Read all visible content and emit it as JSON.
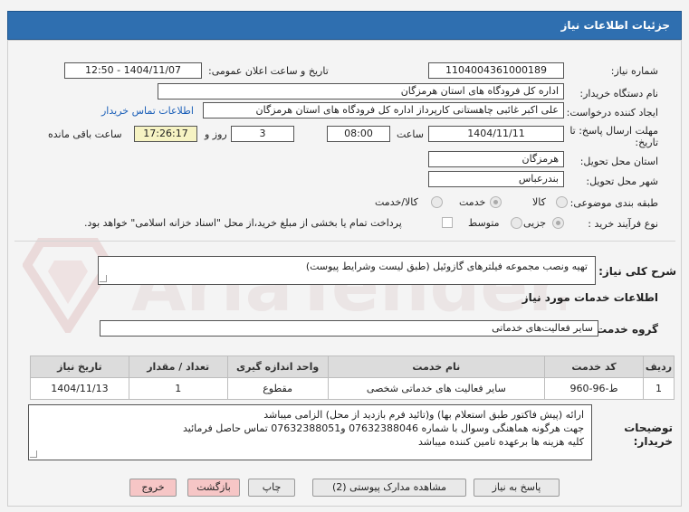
{
  "header": {
    "title": "جزئیات اطلاعات نیاز"
  },
  "fields": {
    "need_number_label": "شماره نیاز:",
    "need_number": "1104004361000189",
    "announce_label": "تاریخ و ساعت اعلان عمومی:",
    "announce_value": "1404/11/07 - 12:50",
    "buyer_org_label": "نام دستگاه خریدار:",
    "buyer_org": "اداره کل فرودگاه های استان هرمزگان",
    "requester_label": "ایجاد کننده درخواست:",
    "requester": "علی اکبر غائبی چاهستانی کارپرداز اداره کل فرودگاه های استان هرمزگان",
    "contact_link": "اطلاعات تماس خریدار",
    "deadline_label_1": "مهلت ارسال پاسخ: تا",
    "deadline_label_2": "تاریخ:",
    "deadline_date": "1404/11/11",
    "time_label": "ساعت",
    "deadline_time": "08:00",
    "days_value": "3",
    "days_label": "روز و",
    "remaining_time": "17:26:17",
    "remaining_label": "ساعت باقی مانده",
    "province_label": "استان محل تحویل:",
    "province": "هرمزگان",
    "city_label": "شهر محل تحویل:",
    "city": "بندرعباس",
    "category_label": "طبقه بندی موضوعی:",
    "category_options": [
      "کالا",
      "خدمت",
      "کالا/خدمت"
    ],
    "purchase_type_label": "نوع فرآیند خرید :",
    "purchase_options": [
      "جزیی",
      "متوسط"
    ],
    "payment_note": "پرداخت تمام یا بخشی از مبلغ خرید،از محل \"اسناد خزانه اسلامی\" خواهد بود."
  },
  "summary": {
    "label": "شرح کلی نیاز:",
    "value": "تهیه ونصب مجموعه فیلترهای گازوئیل (طبق لیست وشرایط پیوست)"
  },
  "services_title": "اطلاعات خدمات مورد نیاز",
  "service_group": {
    "label": "گروه خدمت:",
    "value": "سایر فعالیت‌های خدماتی"
  },
  "table": {
    "headers": [
      "ردیف",
      "کد خدمت",
      "نام خدمت",
      "واحد اندازه گیری",
      "تعداد / مقدار",
      "تاریخ نیاز"
    ],
    "rows": [
      [
        "1",
        "ط-96-960",
        "سایر فعالیت های خدماتی شخصی",
        "مقطوع",
        "1",
        "1404/11/13"
      ]
    ]
  },
  "notes": {
    "label_1": "توضیحات",
    "label_2": "خریدار:",
    "lines": [
      "ارائه (پیش فاکتور طبق استعلام بها)  و(تائید فرم بازدید از محل)  الزامی میباشد",
      "جهت هرگونه هماهنگی وسوال با شماره 07632388046 و07632388051 تماس حاصل فرمائید",
      "کلیه هزینه ها برعهده تامین کننده میباشد"
    ]
  },
  "buttons": {
    "reply": "پاسخ به نیاز",
    "docs": "مشاهده مدارک پیوستی (2)",
    "print": "چاپ",
    "back": "بازگشت",
    "exit": "خروج"
  },
  "watermark": "AriaTender.net",
  "colors": {
    "header": "#2f6fb0",
    "link": "#1b5fb8",
    "highlight": "#f6f3c3",
    "exit_button": "#f6c6c6"
  }
}
